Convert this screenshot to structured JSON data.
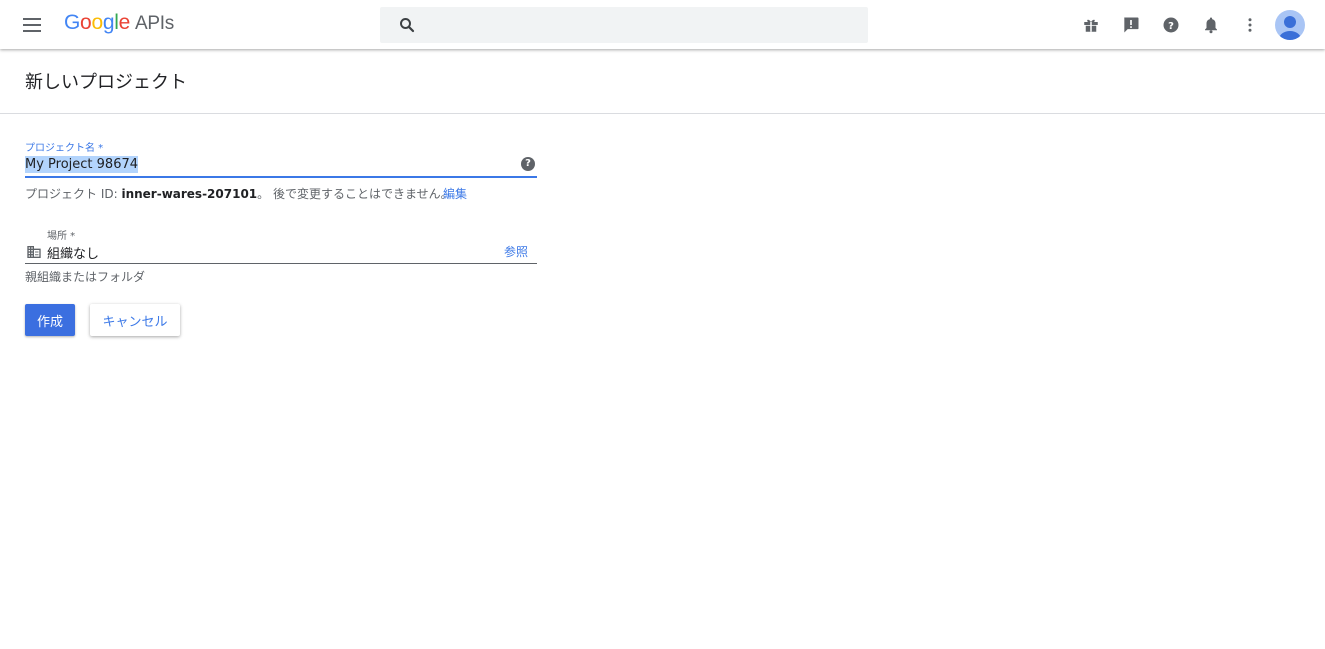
{
  "header": {
    "logo_letters": [
      {
        "ch": "G",
        "color": "#4285F4"
      },
      {
        "ch": "o",
        "color": "#EA4335"
      },
      {
        "ch": "o",
        "color": "#FBBC05"
      },
      {
        "ch": "g",
        "color": "#4285F4"
      },
      {
        "ch": "l",
        "color": "#34A853"
      },
      {
        "ch": "e",
        "color": "#EA4335"
      }
    ],
    "product": "APIs",
    "icons": [
      "menu-icon",
      "search-icon",
      "gift-icon",
      "feedback-icon",
      "help-icon",
      "notifications-icon",
      "more-vert-icon",
      "account-avatar"
    ]
  },
  "page": {
    "title": "新しいプロジェクト"
  },
  "form": {
    "project_name_label": "プロジェクト名 *",
    "project_name_value": "My Project 98674",
    "project_id_prefix": "プロジェクト ID: ",
    "project_id": "inner-wares-207101",
    "project_id_suffix": "。 後で変更することはできません。",
    "edit_link": "編集",
    "location_label": "場所 *",
    "location_value": "組織なし",
    "browse_link": "参照",
    "location_hint": "親組織またはフォルダ",
    "create_button": "作成",
    "cancel_button": "キャンセル"
  },
  "colors": {
    "accent": "#3b78e7",
    "primary_button": "#3b6fe0",
    "selection": "#b3d4fc"
  }
}
